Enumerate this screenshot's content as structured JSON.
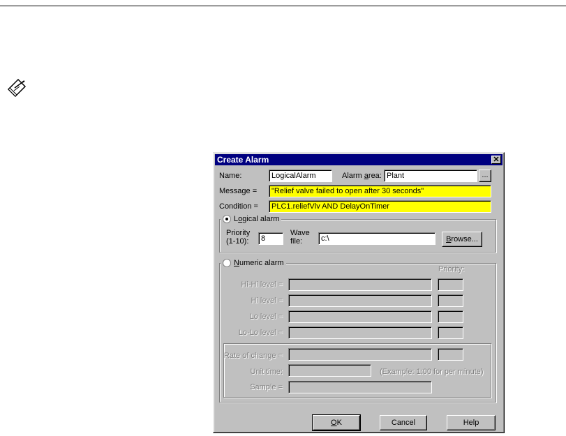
{
  "dialog": {
    "title": "Create Alarm",
    "close_glyph": "✕",
    "name_label": "Name:",
    "name_value": "LogicalAlarm",
    "area_label": "Alarm area:",
    "area_value": "Plant",
    "area_browse": "...",
    "message_label": "Message =",
    "message_value": "\"Relief valve failed to open after 30 seconds\"",
    "condition_label": "Condition =",
    "condition_value": "PLC1.reliefVlv AND DelayOnTimer",
    "logical": {
      "label": "Logical alarm",
      "selected": true,
      "priority_label": "Priority (1-10):",
      "priority_value": "8",
      "wave_label": "Wave file:",
      "wave_value": "c:\\",
      "browse_label": "Browse..."
    },
    "numeric": {
      "label": "Numeric alarm",
      "selected": false,
      "priority_header": "Priority:",
      "hihi_label": "Hi-Hi level =",
      "hi_label": "Hi level =",
      "lo_label": "Lo level =",
      "lolo_label": "Lo-Lo level =",
      "rate_label": "Rate of change =",
      "unit_label": "Unit time:",
      "unit_hint": "(Example: 1:00 for per minute)",
      "sample_label": "Sample ="
    },
    "ok_label": "OK",
    "cancel_label": "Cancel",
    "help_label": "Help"
  },
  "icons": {
    "note": "note-pencil-icon"
  }
}
